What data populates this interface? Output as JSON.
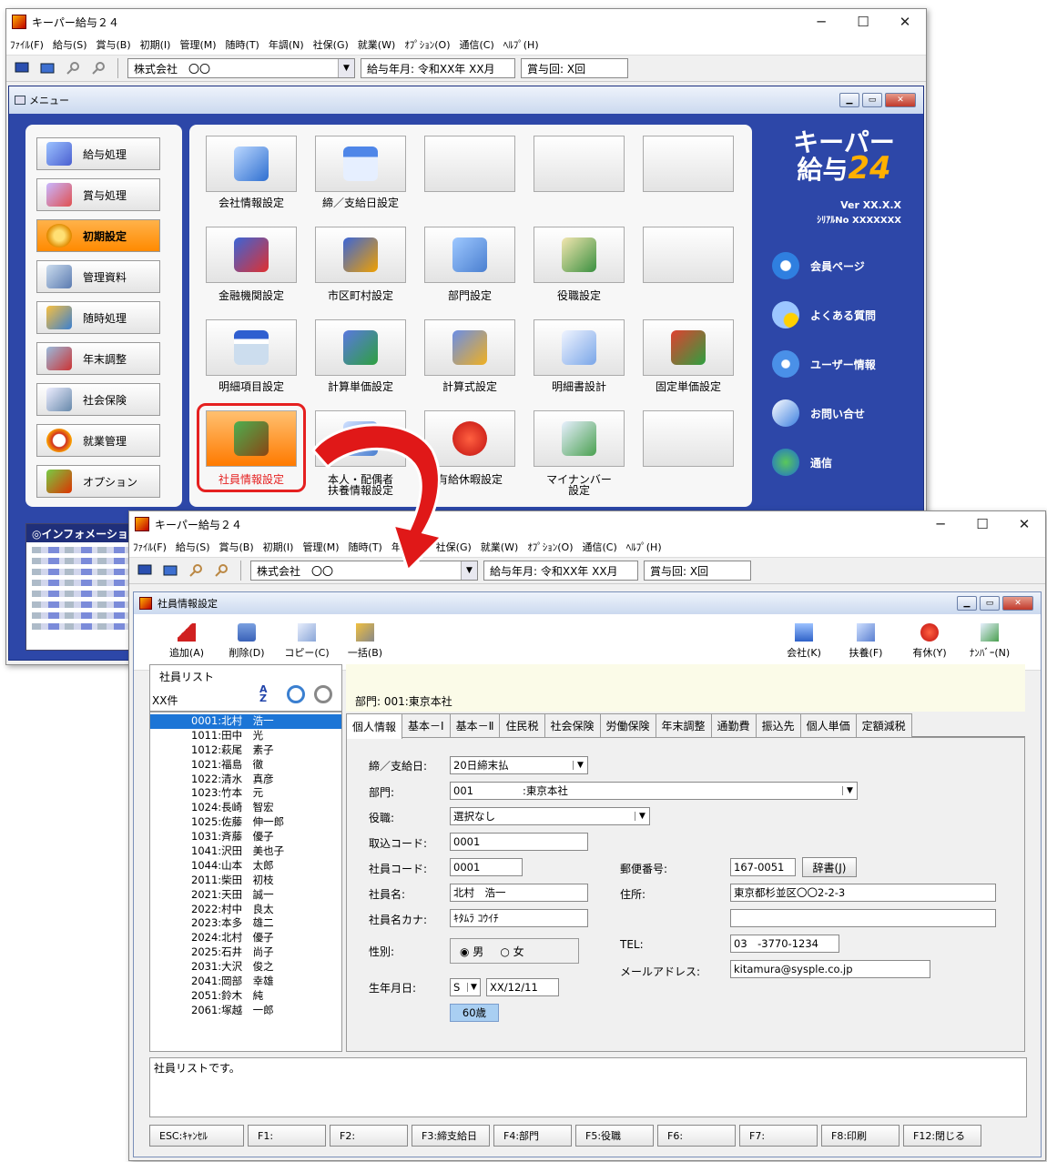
{
  "app_title": "キーパー給与２４",
  "menubar": [
    "ﾌｧｲﾙ(F)",
    "給与(S)",
    "賞与(B)",
    "初期(I)",
    "管理(M)",
    "随時(T)",
    "年調(N)",
    "社保(G)",
    "就業(W)",
    "ｵﾌﾟｼｮﾝ(O)",
    "通信(C)",
    "ﾍﾙﾌﾟ(H)"
  ],
  "toolbar": {
    "company": "株式会社　〇〇",
    "pay_month": "給与年月: 令和XX年 XX月",
    "bonus_count": "賞与回: X回"
  },
  "menu_window": {
    "title": "メニュー",
    "left_menu": [
      "給与処理",
      "賞与処理",
      "初期設定",
      "管理資料",
      "随時処理",
      "年末調整",
      "社会保険",
      "就業管理",
      "オプション"
    ],
    "grid": [
      {
        "label": "会社情報設定"
      },
      {
        "label": "締／支給日設定"
      },
      {
        "label": ""
      },
      {
        "label": ""
      },
      {
        "label": ""
      },
      {
        "label": "金融機関設定"
      },
      {
        "label": "市区町村設定"
      },
      {
        "label": "部門設定"
      },
      {
        "label": "役職設定"
      },
      {
        "label": ""
      },
      {
        "label": "明細項目設定"
      },
      {
        "label": "計算単価設定"
      },
      {
        "label": "計算式設定"
      },
      {
        "label": "明細書設計"
      },
      {
        "label": "固定単価設定"
      },
      {
        "label": "社員情報設定"
      },
      {
        "label": "本人・配偶者\n扶養情報設定"
      },
      {
        "label": "有給休暇設定"
      },
      {
        "label": "マイナンバー\n設定"
      },
      {
        "label": ""
      }
    ],
    "brand_line1": "キーパー",
    "brand_line2": "給与",
    "brand_num": "24",
    "version": "Ver XX.X.X",
    "serial": "ｼﾘｱﾙNo XXXXXXX",
    "links": [
      "会員ページ",
      "よくある質問",
      "ユーザー情報",
      "お問い合せ",
      "通信"
    ],
    "info_title": "◎インフォメーション"
  },
  "emp_window": {
    "title": "社員情報設定",
    "actions": [
      "追加(A)",
      "削除(D)",
      "コピー(C)",
      "一括(B)"
    ],
    "actions_right": [
      "会社(K)",
      "扶養(F)",
      "有休(Y)",
      "ﾅﾝﾊﾞｰ(N)"
    ],
    "list_title": "社員リスト",
    "list_count": "XX件",
    "dept": "部門: 001:東京本社",
    "employees": [
      "0001:北村　浩一",
      "1011:田中　光",
      "1012:萩尾　素子",
      "1021:福島　徹",
      "1022:清水　真彦",
      "1023:竹本　元",
      "1024:長崎　智宏",
      "1025:佐藤　伸一郎",
      "1031:斉藤　優子",
      "1041:沢田　美也子",
      "1044:山本　太郎",
      "2011:柴田　初枝",
      "2021:天田　誠一",
      "2022:村中　良太",
      "2023:本多　雄二",
      "2024:北村　優子",
      "2025:石井　尚子",
      "2031:大沢　俊之",
      "2041:岡部　幸雄",
      "2051:鈴木　純",
      "2061:塚越　一郎"
    ],
    "tabs": [
      "個人情報",
      "基本－Ⅰ",
      "基本－Ⅱ",
      "住民税",
      "社会保険",
      "労働保険",
      "年末調整",
      "通勤費",
      "振込先",
      "個人単価",
      "定額減税"
    ],
    "form": {
      "l_close": "締／支給日:",
      "v_close": "20日締末払",
      "l_dept": "部門:",
      "v_dept_code": "001",
      "v_dept_name": ":東京本社",
      "l_post": "役職:",
      "v_post": "選択なし",
      "l_import": "取込コード:",
      "v_import": "0001",
      "l_code": "社員コード:",
      "v_code": "0001",
      "l_name": "社員名:",
      "v_name": "北村　浩一",
      "l_kana": "社員名カナ:",
      "v_kana": "ｷﾀﾑﾗ ｺｳｲﾁ",
      "l_sex": "性別:",
      "male": "男",
      "female": "女",
      "l_birth": "生年月日:",
      "v_era": "S",
      "v_birth": "XX/12/11",
      "v_age": "60歳",
      "l_zip": "郵便番号:",
      "v_zip": "167-0051",
      "dict_btn": "辞書(J)",
      "l_addr": "住所:",
      "v_addr": "東京都杉並区〇〇2-2-3",
      "v_addr2": "",
      "l_tel": "TEL:",
      "v_tel": "03　-3770-1234",
      "l_mail": "メールアドレス:",
      "v_mail": "kitamura@sysple.co.jp"
    },
    "status": "社員リストです。",
    "fkeys": [
      "ESC:ｷｬﾝｾﾙ",
      "F1:",
      "F2:",
      "F3:締支給日",
      "F4:部門",
      "F5:役職",
      "F6:",
      "F7:",
      "F8:印刷",
      "F12:閉じる"
    ]
  }
}
